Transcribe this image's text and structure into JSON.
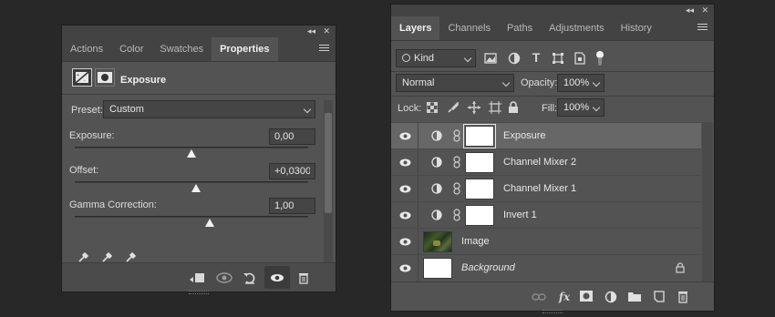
{
  "properties_panel": {
    "collapse_glyph": "◂◂",
    "close_glyph": "✕",
    "tabs": [
      {
        "label": "Actions",
        "active": false
      },
      {
        "label": "Color",
        "active": false
      },
      {
        "label": "Swatches",
        "active": false
      },
      {
        "label": "Properties",
        "active": true
      }
    ],
    "header_title": "Exposure",
    "preset_label": "Preset:",
    "preset_value": "Custom",
    "sliders": [
      {
        "label": "Exposure:",
        "value": "0,00",
        "thumb_fraction": 0.5
      },
      {
        "label": "Offset:",
        "value": "+0,0300",
        "thumb_fraction": 0.52
      },
      {
        "label": "Gamma Correction:",
        "value": "1,00",
        "thumb_fraction": 0.58
      }
    ],
    "eyedroppers": [
      "eyedropper-black-icon",
      "eyedropper-gray-icon",
      "eyedropper-white-icon"
    ],
    "footer_icons": [
      "clip-to-layer-icon",
      "view-previous-state-icon",
      "reset-icon",
      "visibility-icon",
      "trash-icon"
    ]
  },
  "layers_panel": {
    "collapse_glyph": "◂◂",
    "close_glyph": "✕",
    "tabs": [
      {
        "label": "Layers",
        "active": true
      },
      {
        "label": "Channels",
        "active": false
      },
      {
        "label": "Paths",
        "active": false
      },
      {
        "label": "Adjustments",
        "active": false
      },
      {
        "label": "History",
        "active": false
      }
    ],
    "filter_kind": "Kind",
    "blend_mode": "Normal",
    "opacity_label": "Opacity:",
    "opacity_value": "100%",
    "lock_label": "Lock:",
    "fill_label": "Fill:",
    "fill_value": "100%",
    "layers": [
      {
        "name": "Exposure",
        "type": "adjustment",
        "selected": true
      },
      {
        "name": "Channel Mixer 2",
        "type": "adjustment",
        "selected": false
      },
      {
        "name": "Channel Mixer 1",
        "type": "adjustment",
        "selected": false
      },
      {
        "name": "Invert 1",
        "type": "adjustment",
        "selected": false
      },
      {
        "name": "Image",
        "type": "image",
        "selected": false
      },
      {
        "name": "Background",
        "type": "background",
        "selected": false
      }
    ],
    "footer_icons": [
      "link-layers-icon",
      "fx-icon",
      "add-mask-icon",
      "new-adjustment-icon",
      "new-group-icon",
      "new-layer-icon",
      "trash-icon"
    ]
  }
}
